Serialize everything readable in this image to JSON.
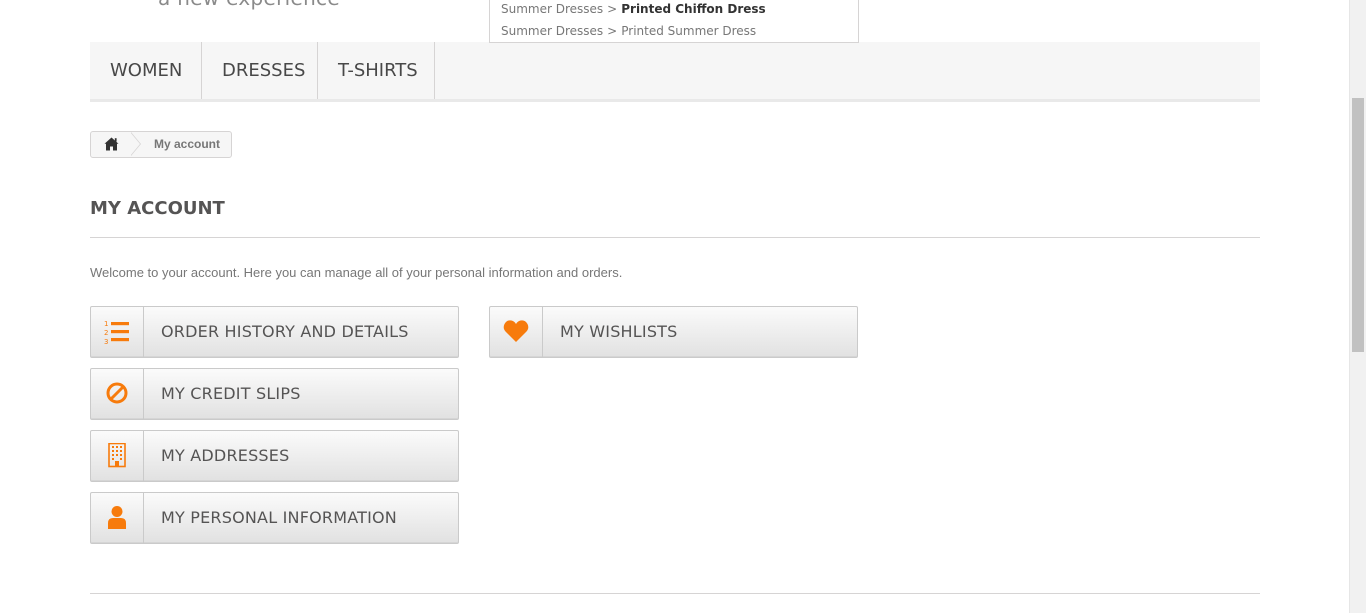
{
  "header": {
    "tagline_fragment": "a new experience"
  },
  "search_autocomplete": {
    "items": [
      {
        "category": "Summer Dresses",
        "separator": ">",
        "product": "Printed Chiffon Dress"
      },
      {
        "category": "Summer Dresses",
        "separator": ">",
        "product": "Printed Summer Dress"
      }
    ]
  },
  "top_menu": {
    "items": [
      {
        "label": "WOMEN"
      },
      {
        "label": "DRESSES"
      },
      {
        "label": "T-SHIRTS"
      }
    ]
  },
  "breadcrumb": {
    "home_icon": "home-icon",
    "current": "My account"
  },
  "page": {
    "heading": "MY ACCOUNT",
    "welcome": "Welcome to your account. Here you can manage all of your personal information and orders."
  },
  "account_links": {
    "order_history": {
      "label": "ORDER HISTORY AND DETAILS",
      "icon": "ordered-list-icon"
    },
    "credit_slips": {
      "label": "MY CREDIT SLIPS",
      "icon": "ban-circle-icon"
    },
    "addresses": {
      "label": "MY ADDRESSES",
      "icon": "building-icon"
    },
    "personal_info": {
      "label": "MY PERSONAL INFORMATION",
      "icon": "user-icon"
    },
    "wishlists": {
      "label": "MY WISHLISTS",
      "icon": "heart-icon"
    }
  },
  "colors": {
    "accent": "#f77b0c",
    "menu_background": "#f6f6f6",
    "border": "#d6d4d4",
    "text": "#555454"
  }
}
